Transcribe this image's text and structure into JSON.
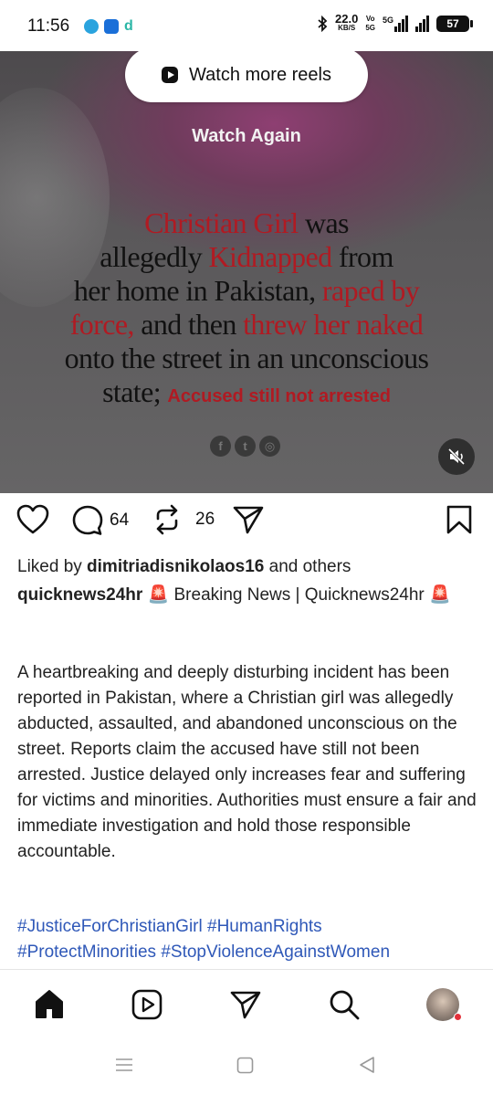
{
  "status_bar": {
    "time": "11:56",
    "speed_value": "22.0",
    "speed_unit": "KB/S",
    "volte_top": "Vo",
    "volte_bottom": "5G",
    "network": "5G",
    "battery": "57"
  },
  "video": {
    "watch_more_label": "Watch more reels",
    "watch_again_label": "Watch Again",
    "headline": {
      "l1_red": "Christian Girl",
      "l1_black": " was",
      "l2_black": "allegedly ",
      "l2_red": "Kidnapped",
      "l2_black2": " from",
      "l3_black": "her home in Pakistan, ",
      "l3_red": "raped by",
      "l4_red": "force,",
      "l4_black": " and then ",
      "l4_red2": "threw her naked",
      "l5_black": "onto the street in an unconscious",
      "l6_black": "state; ",
      "l6_red": "Accused still not arrested"
    },
    "social_icons": [
      "facebook-icon",
      "twitter-icon",
      "instagram-icon"
    ]
  },
  "actions": {
    "comments_count": "64",
    "reposts_count": "26"
  },
  "post": {
    "liked_prefix": "Liked by ",
    "liked_user": "dimitriadisnikolaos16",
    "liked_suffix": " and others",
    "username": "quicknews24hr",
    "caption_head": " 🚨 Breaking News | Quicknews24hr 🚨",
    "body": "A heartbreaking and deeply disturbing incident has been reported in Pakistan, where a Christian girl was allegedly abducted, assaulted, and abandoned unconscious on the street. Reports claim the accused have still not been arrested. Justice delayed only increases fear and suffering for victims and minorities. Authorities must ensure a fair and immediate investigation and hold those responsible accountable.",
    "hashtags_line1": "#JusticeForChristianGirl #HumanRights",
    "hashtags_line2": "#ProtectMinorities #StopViolenceAgainstWomen"
  },
  "colors": {
    "accent_red": "#b01a22",
    "hashtag_blue": "#2f58b8",
    "notification_dot": "#e3303a"
  }
}
